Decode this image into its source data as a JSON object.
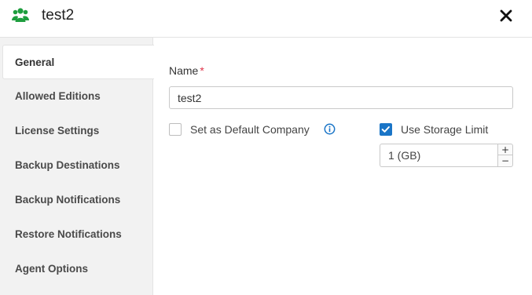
{
  "header": {
    "icon": "company-users-icon",
    "title": "test2",
    "close_icon": "close-icon",
    "accent": "#1e9e3e"
  },
  "sidebar": {
    "items": [
      {
        "label": "General",
        "active": true
      },
      {
        "label": "Allowed Editions",
        "active": false
      },
      {
        "label": "License Settings",
        "active": false
      },
      {
        "label": "Backup Destinations",
        "active": false
      },
      {
        "label": "Backup Notifications",
        "active": false
      },
      {
        "label": "Restore Notifications",
        "active": false
      },
      {
        "label": "Agent Options",
        "active": false
      }
    ]
  },
  "form": {
    "name_label": "Name",
    "required_mark": "*",
    "name_value": "test2",
    "default_company": {
      "label": "Set as Default Company",
      "checked": false,
      "info_icon": "info-icon"
    },
    "storage_limit": {
      "label": "Use Storage Limit",
      "checked": true,
      "value": "1 (GB)",
      "increment": "+",
      "decrement": "−"
    }
  },
  "colors": {
    "checkbox_checked": "#1a75c7",
    "required": "#e0344a",
    "icon_green": "#1e9e3e"
  }
}
